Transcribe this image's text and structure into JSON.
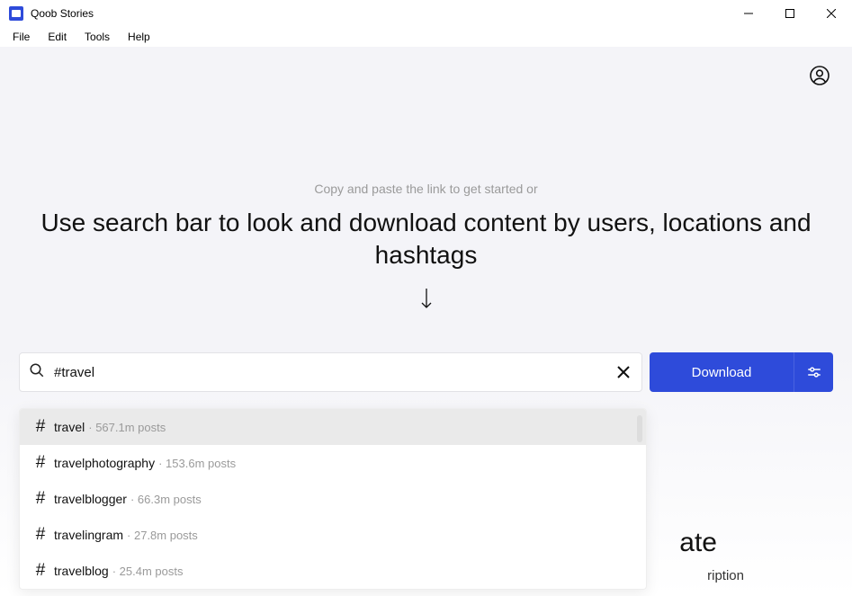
{
  "title": "Qoob Stories",
  "menu": {
    "file": "File",
    "edit": "Edit",
    "tools": "Tools",
    "help": "Help"
  },
  "hero": {
    "subtitle": "Copy and paste the link to get started or",
    "headline": "Use search bar to look and download content by users, locations and hashtags"
  },
  "search": {
    "value": "#travel",
    "download": "Download"
  },
  "suggestions": [
    {
      "tag": "travel",
      "count": "567.1m posts",
      "selected": true
    },
    {
      "tag": "travelphotography",
      "count": "153.6m posts",
      "selected": false
    },
    {
      "tag": "travelblogger",
      "count": "66.3m posts",
      "selected": false
    },
    {
      "tag": "travelingram",
      "count": "27.8m posts",
      "selected": false
    },
    {
      "tag": "travelblog",
      "count": "25.4m posts",
      "selected": false
    }
  ],
  "teaser": {
    "big_fragment": "ate",
    "small_fragment": "ription"
  }
}
